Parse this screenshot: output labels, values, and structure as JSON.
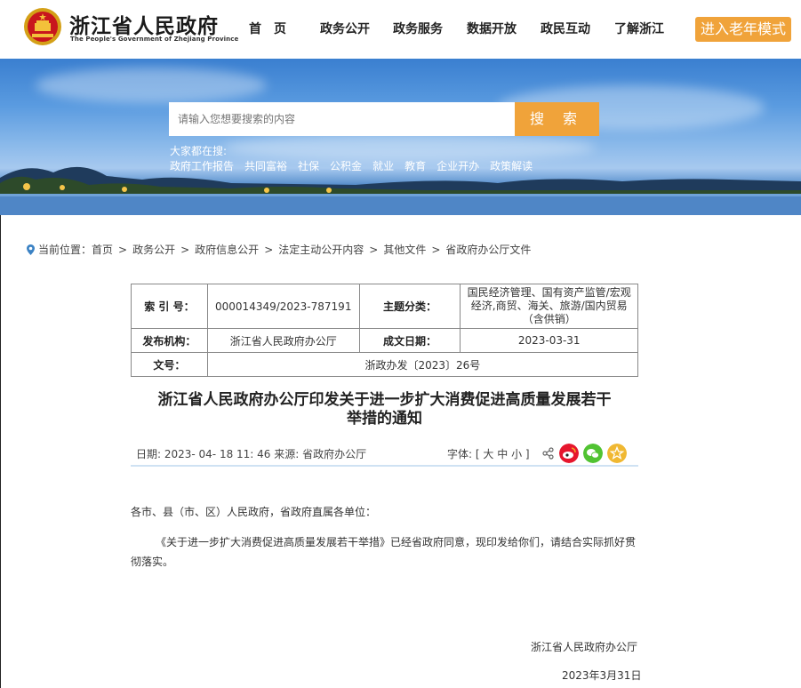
{
  "header": {
    "title": "浙江省人民政府",
    "subtitle": "The People's Government of Zhejiang Province",
    "nav": [
      "首　页",
      "政务公开",
      "政务服务",
      "数据开放",
      "政民互动",
      "了解浙江"
    ],
    "elder_mode": "进入老年模式"
  },
  "banner": {
    "search_placeholder": "请输入您想要搜索的内容",
    "search_button": "搜 索",
    "hot_label": "大家都在搜:",
    "hot_links": [
      "政府工作报告",
      "共同富裕",
      "社保",
      "公积金",
      "就业",
      "教育",
      "企业开办",
      "政策解读"
    ]
  },
  "breadcrumb": {
    "label": "当前位置：",
    "items": [
      "首页",
      "政务公开",
      "政府信息公开",
      "法定主动公开内容",
      "其他文件",
      "省政府办公厅文件"
    ]
  },
  "info": {
    "index_key": "索 引 号：",
    "index_val": "000014349/2023-787191",
    "topic_key": "主题分类：",
    "topic_val": "国民经济管理、国有资产监管/宏观经济,商贸、海关、旅游/国内贸易（含供销）",
    "issuer_key": "发布机构：",
    "issuer_val": "浙江省人民政府办公厅",
    "date_key": "成文日期：",
    "date_val": "2023-03-31",
    "docno_key": "文号：",
    "docno_val": "浙政办发〔2023〕26号"
  },
  "article": {
    "title_line1": "浙江省人民政府办公厅印发关于进一步扩大消费促进高质量发展若干",
    "title_line2": "举措的通知",
    "date": "日期:  2023- 04- 18 11: 46  来源:   省政府办公厅",
    "font_label": "字体: [",
    "font_large": "大",
    "font_mid": "中",
    "font_small": "小",
    "font_close": "]",
    "salutation": "各市、县（市、区）人民政府，省政府直属各单位：",
    "body_line1": "《关于进一步扩大消费促进高质量发展若干举措》已经省政府同意，现印发给你们，请结合实际抓好贯",
    "body_line2": "彻落实。",
    "signature": "浙江省人民政府办公厅",
    "sign_date": "2023年3月31日"
  },
  "colors": {
    "accent": "#f0a33a",
    "weibo": "#e6162d",
    "wechat": "#51c332",
    "favorite": "#f0b832"
  }
}
